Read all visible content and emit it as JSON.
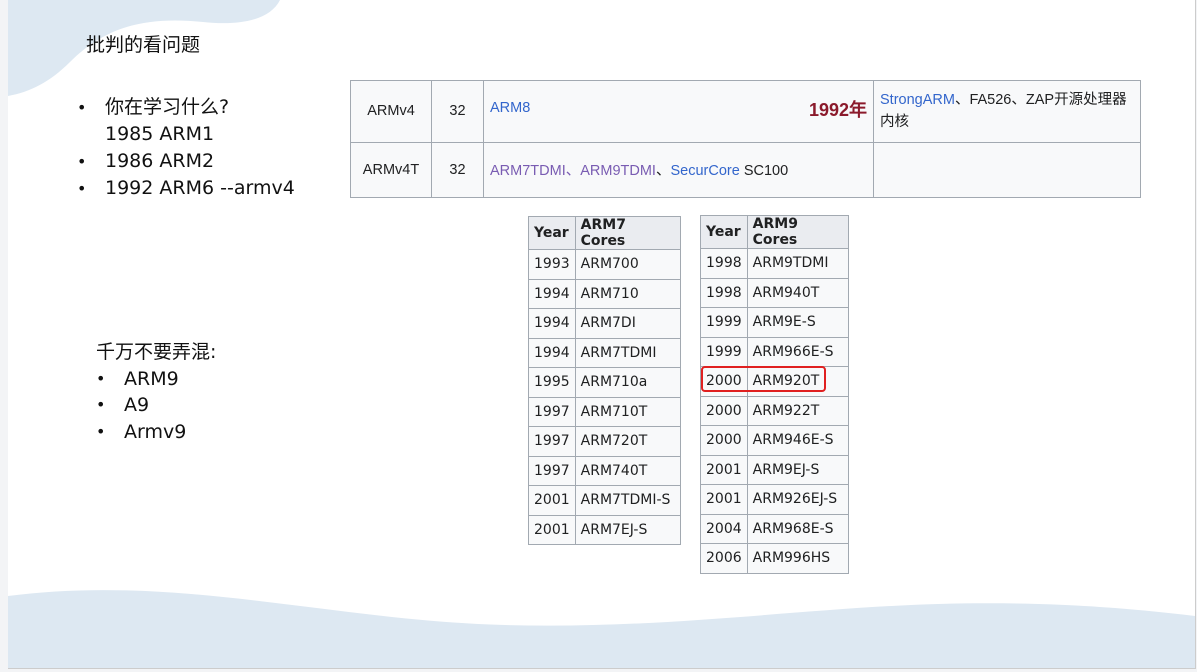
{
  "slide": {
    "title": "批判的看问题",
    "questions": [
      {
        "bullet": true,
        "text": "你在学习什么?"
      },
      {
        "bullet": false,
        "text": "1985  ARM1"
      },
      {
        "bullet": true,
        "text": "1986  ARM2"
      },
      {
        "bullet": true,
        "text": "1992  ARM6 --armv4"
      }
    ],
    "caution_heading": "千万不要弄混:",
    "caution_items": [
      "ARM9",
      "A9",
      "Armv9"
    ]
  },
  "wiki_table": {
    "rows": [
      {
        "arch": "ARMv4",
        "bits": "32",
        "family": [
          "ARM8"
        ],
        "year_note": "1992年",
        "third_party_links": [
          "StrongARM"
        ],
        "third_party_text": "、FA526、ZAP开源处理器内核"
      },
      {
        "arch": "ARMv4T",
        "bits": "32",
        "family_links": [
          "ARM7TDMI",
          "ARM9TDMI",
          "SecurCore"
        ],
        "family_text": "SC100",
        "third_party": ""
      }
    ]
  },
  "arm7_table": {
    "headers": [
      "Year",
      "ARM7 Cores"
    ],
    "rows": [
      [
        "1993",
        "ARM700"
      ],
      [
        "1994",
        "ARM710"
      ],
      [
        "1994",
        "ARM7DI"
      ],
      [
        "1994",
        "ARM7TDMI"
      ],
      [
        "1995",
        "ARM710a"
      ],
      [
        "1997",
        "ARM710T"
      ],
      [
        "1997",
        "ARM720T"
      ],
      [
        "1997",
        "ARM740T"
      ],
      [
        "2001",
        "ARM7TDMI-S"
      ],
      [
        "2001",
        "ARM7EJ-S"
      ]
    ]
  },
  "arm9_table": {
    "headers": [
      "Year",
      "ARM9 Cores"
    ],
    "rows": [
      [
        "1998",
        "ARM9TDMI"
      ],
      [
        "1998",
        "ARM940T"
      ],
      [
        "1999",
        "ARM9E-S"
      ],
      [
        "1999",
        "ARM966E-S"
      ],
      [
        "2000",
        "ARM920T"
      ],
      [
        "2000",
        "ARM922T"
      ],
      [
        "2000",
        "ARM946E-S"
      ],
      [
        "2001",
        "ARM9EJ-S"
      ],
      [
        "2001",
        "ARM926EJ-S"
      ],
      [
        "2004",
        "ARM968E-S"
      ],
      [
        "2006",
        "ARM996HS"
      ]
    ],
    "highlighted_row": 4,
    "highlight_color": "#e02020"
  },
  "colors": {
    "link": "#3366cc",
    "visited_link": "#795cb2",
    "year_note": "#8b1a2b",
    "wave": "#dde8f2"
  }
}
